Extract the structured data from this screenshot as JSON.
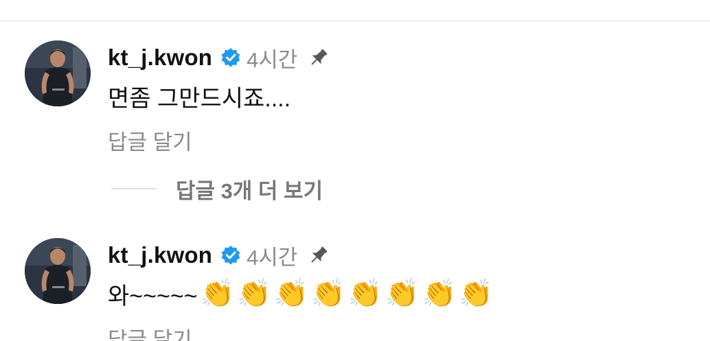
{
  "comments": [
    {
      "username": "kt_j.kwon",
      "time": "4시간",
      "text": "면좀 그만드시죠....",
      "reply_label": "답글 달기",
      "more_replies_label": "답글 3개 더 보기"
    },
    {
      "username": "kt_j.kwon",
      "time": "4시간",
      "text": "와~~~~~",
      "claps": [
        "👏",
        "👏",
        "👏",
        "👏",
        "👏",
        "👏",
        "👏",
        "👏"
      ],
      "reply_label": "답글 달기"
    }
  ],
  "colors": {
    "verified": "#1d9bf0",
    "muted_text": "#8a8a8a",
    "primary_text": "#111111",
    "divider": "#e6e6e6"
  },
  "icons": [
    "avatar",
    "verified-badge-icon",
    "pin-icon",
    "clapping-hands-icon"
  ]
}
